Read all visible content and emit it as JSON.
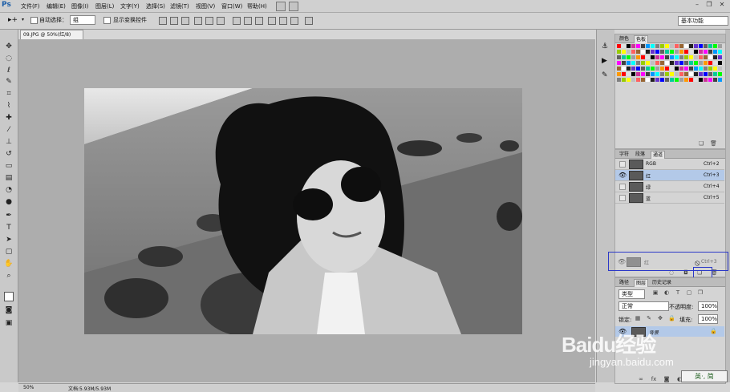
{
  "app": {
    "logo": "Ps",
    "workspace": "基本功能"
  },
  "menu": [
    "文件(F)",
    "编辑(E)",
    "图像(I)",
    "图层(L)",
    "文字(Y)",
    "选择(S)",
    "滤镜(T)",
    "视图(V)",
    "窗口(W)",
    "帮助(H)"
  ],
  "options": {
    "auto_select_label": "自动选择：",
    "auto_select_value": "组",
    "show_transform_label": "显示变换控件"
  },
  "document": {
    "tab_title": "09.JPG @ 50%(红/8)",
    "zoom": "50%",
    "doc_info": "文档:5.93M/5.93M"
  },
  "swatches_panel": {
    "tabs": [
      "颜色",
      "色板"
    ],
    "active": "色板"
  },
  "channels_panel": {
    "tabs": [
      "字符",
      "段落",
      "通道"
    ],
    "active": "通道",
    "rows": [
      {
        "name": "RGB",
        "shortcut": "Ctrl+2",
        "visible": false,
        "selected": false
      },
      {
        "name": "红",
        "shortcut": "Ctrl+3",
        "visible": true,
        "selected": true
      },
      {
        "name": "绿",
        "shortcut": "Ctrl+4",
        "visible": false,
        "selected": false
      },
      {
        "name": "蓝",
        "shortcut": "Ctrl+5",
        "visible": false,
        "selected": false
      }
    ],
    "drag_row": {
      "name": "红",
      "shortcut": "Ctrl+3"
    }
  },
  "layers_panel": {
    "tabs": [
      "路径",
      "图层",
      "历史记录"
    ],
    "active": "图层",
    "filter": "类型",
    "blend_mode": "正常",
    "opacity_label": "不透明度:",
    "opacity": "100%",
    "lock_label": "锁定:",
    "fill_label": "填充:",
    "fill": "100%",
    "layer_name": "背景"
  },
  "watermark": {
    "text": "Baidu经验",
    "url": "jingyan.baidu.com",
    "ime": "英·, 简"
  },
  "colors": {
    "accent": "#b3c9e8",
    "highlight_box": "#2a37c8"
  }
}
